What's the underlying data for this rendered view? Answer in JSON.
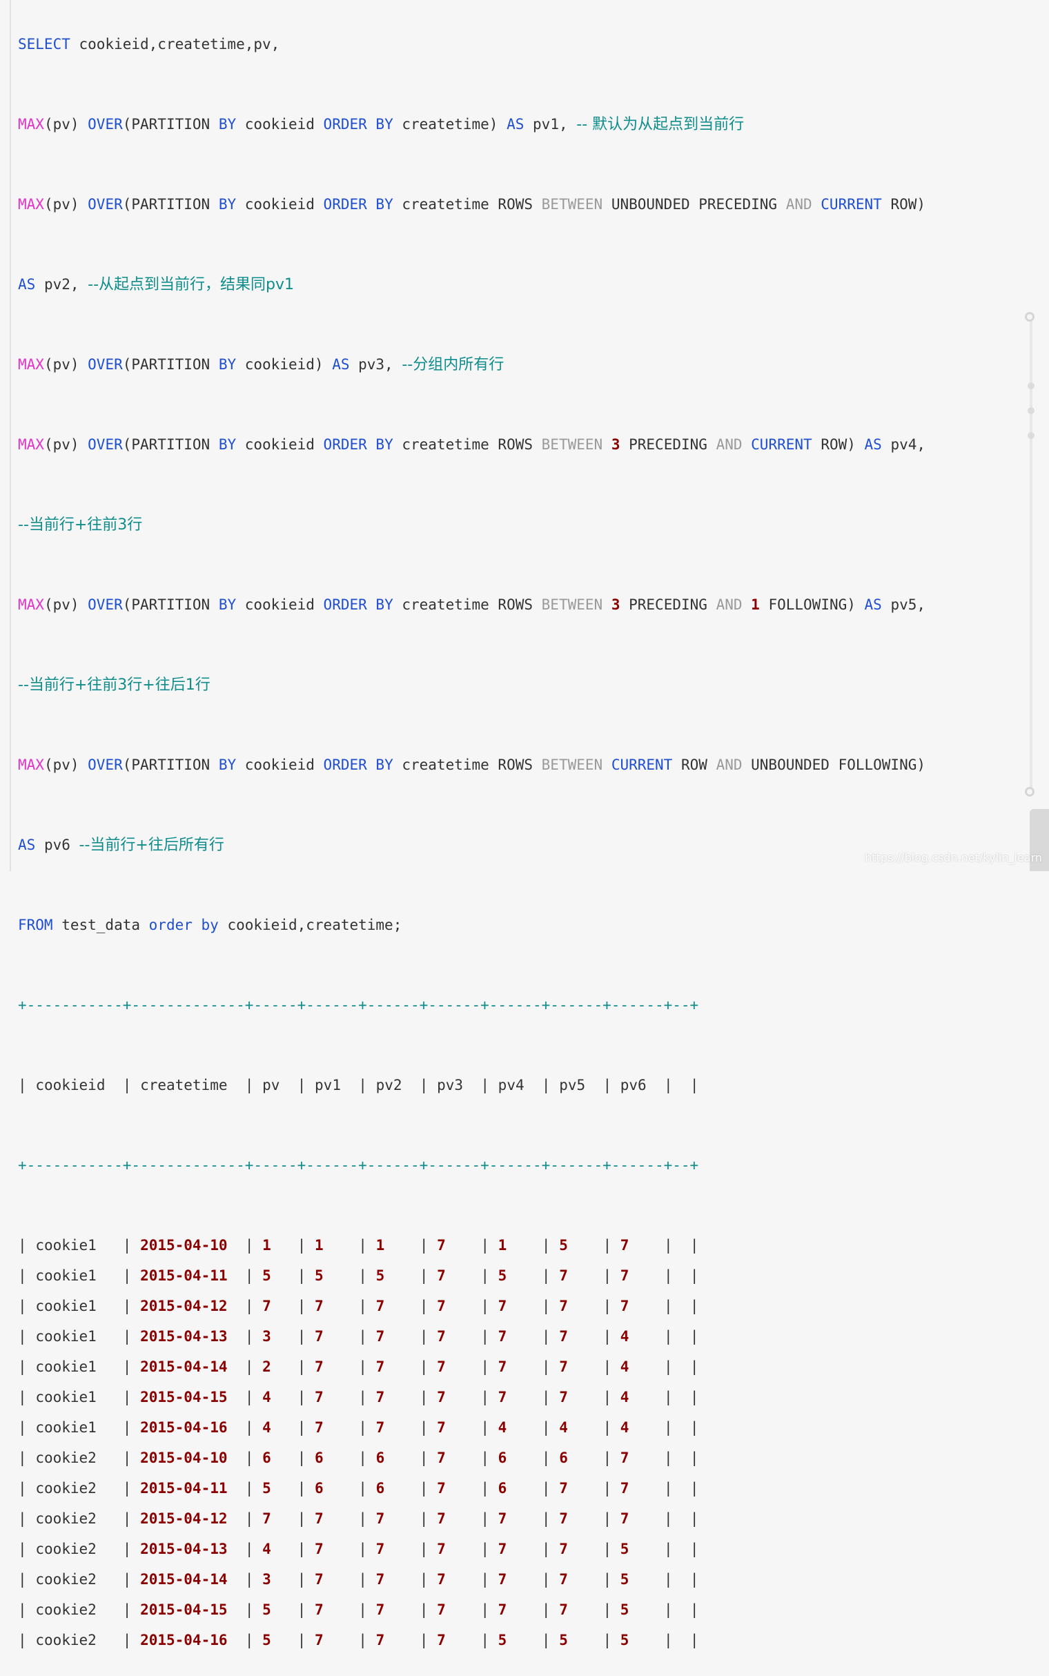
{
  "sql": {
    "l1": {
      "select": "SELECT",
      "cols": " cookieid,createtime,pv,"
    },
    "l2": {
      "fn": "MAX",
      "a": "(pv) ",
      "over": "OVER",
      "b": "(PARTITION ",
      "by1": "BY",
      "c": " cookieid ",
      "order": "ORDER",
      "sp": " ",
      "by2": "BY",
      "d": " createtime) ",
      "as": "AS",
      "e": " pv1, ",
      "comment": "-- 默认为从起点到当前行"
    },
    "l3": {
      "fn": "MAX",
      "a": "(pv) ",
      "over": "OVER",
      "b": "(PARTITION ",
      "by1": "BY",
      "c": " cookieid ",
      "order": "ORDER",
      "sp": " ",
      "by2": "BY",
      "d": " createtime ROWS ",
      "between": "BETWEEN",
      "e": " UNBOUNDED PRECEDING ",
      "and": "AND",
      "sp2": " ",
      "current": "CURRENT",
      "f": " ROW)"
    },
    "l4": {
      "as": "AS",
      "a": " pv2, ",
      "comment": "--从起点到当前行，结果同pv1"
    },
    "l5": {
      "fn": "MAX",
      "a": "(pv) ",
      "over": "OVER",
      "b": "(PARTITION ",
      "by1": "BY",
      "c": " cookieid) ",
      "as": "AS",
      "d": " pv3, ",
      "comment": "--分组内所有行"
    },
    "l6": {
      "fn": "MAX",
      "a": "(pv) ",
      "over": "OVER",
      "b": "(PARTITION ",
      "by1": "BY",
      "c": " cookieid ",
      "order": "ORDER",
      "sp": " ",
      "by2": "BY",
      "d": " createtime ROWS ",
      "between": "BETWEEN",
      "sp2": " ",
      "n1": "3",
      "e": " PRECEDING ",
      "and": "AND",
      "sp3": " ",
      "current": "CURRENT",
      "f": " ROW) ",
      "as": "AS",
      "g": " pv4,"
    },
    "l7": {
      "comment": "--当前行+往前3行"
    },
    "l8": {
      "fn": "MAX",
      "a": "(pv) ",
      "over": "OVER",
      "b": "(PARTITION ",
      "by1": "BY",
      "c": " cookieid ",
      "order": "ORDER",
      "sp": " ",
      "by2": "BY",
      "d": " createtime ROWS ",
      "between": "BETWEEN",
      "sp2": " ",
      "n1": "3",
      "e": " PRECEDING ",
      "and": "AND",
      "sp3": " ",
      "n2": "1",
      "f": " FOLLOWING) ",
      "as": "AS",
      "g": " pv5,"
    },
    "l9": {
      "comment": "--当前行+往前3行+往后1行"
    },
    "l10": {
      "fn": "MAX",
      "a": "(pv) ",
      "over": "OVER",
      "b": "(PARTITION ",
      "by1": "BY",
      "c": " cookieid ",
      "order": "ORDER",
      "sp": " ",
      "by2": "BY",
      "d": " createtime ROWS ",
      "between": "BETWEEN",
      "sp2": " ",
      "current": "CURRENT",
      "e": " ROW ",
      "and": "AND",
      "f": " UNBOUNDED FOLLOWING)"
    },
    "l11": {
      "as": "AS",
      "a": " pv6 ",
      "comment": "--当前行+往后所有行"
    },
    "l12": {
      "from": "FROM",
      "a": " test_data ",
      "order": "order",
      "sp": " ",
      "by": "by",
      "b": " cookieid,createtime;"
    }
  },
  "result": {
    "border": "+-----------+-------------+-----+------+------+------+------+------+------+--+",
    "headers": [
      "cookieid",
      "createtime",
      "pv",
      "pv1",
      "pv2",
      "pv3",
      "pv4",
      "pv5",
      "pv6"
    ],
    "rows": [
      [
        "cookie1",
        "2015-04-10",
        "1",
        "1",
        "1",
        "7",
        "1",
        "5",
        "7"
      ],
      [
        "cookie1",
        "2015-04-11",
        "5",
        "5",
        "5",
        "7",
        "5",
        "7",
        "7"
      ],
      [
        "cookie1",
        "2015-04-12",
        "7",
        "7",
        "7",
        "7",
        "7",
        "7",
        "7"
      ],
      [
        "cookie1",
        "2015-04-13",
        "3",
        "7",
        "7",
        "7",
        "7",
        "7",
        "4"
      ],
      [
        "cookie1",
        "2015-04-14",
        "2",
        "7",
        "7",
        "7",
        "7",
        "7",
        "4"
      ],
      [
        "cookie1",
        "2015-04-15",
        "4",
        "7",
        "7",
        "7",
        "7",
        "7",
        "4"
      ],
      [
        "cookie1",
        "2015-04-16",
        "4",
        "7",
        "7",
        "7",
        "4",
        "4",
        "4"
      ],
      [
        "cookie2",
        "2015-04-10",
        "6",
        "6",
        "6",
        "7",
        "6",
        "6",
        "7"
      ],
      [
        "cookie2",
        "2015-04-11",
        "5",
        "6",
        "6",
        "7",
        "6",
        "7",
        "7"
      ],
      [
        "cookie2",
        "2015-04-12",
        "7",
        "7",
        "7",
        "7",
        "7",
        "7",
        "7"
      ],
      [
        "cookie2",
        "2015-04-13",
        "4",
        "7",
        "7",
        "7",
        "7",
        "7",
        "5"
      ],
      [
        "cookie2",
        "2015-04-14",
        "3",
        "7",
        "7",
        "7",
        "7",
        "7",
        "5"
      ],
      [
        "cookie2",
        "2015-04-15",
        "5",
        "7",
        "7",
        "7",
        "7",
        "7",
        "5"
      ],
      [
        "cookie2",
        "2015-04-16",
        "5",
        "7",
        "7",
        "7",
        "5",
        "5",
        "5"
      ]
    ]
  },
  "watermark": "https://blog.csdn.net/kylin_learn"
}
